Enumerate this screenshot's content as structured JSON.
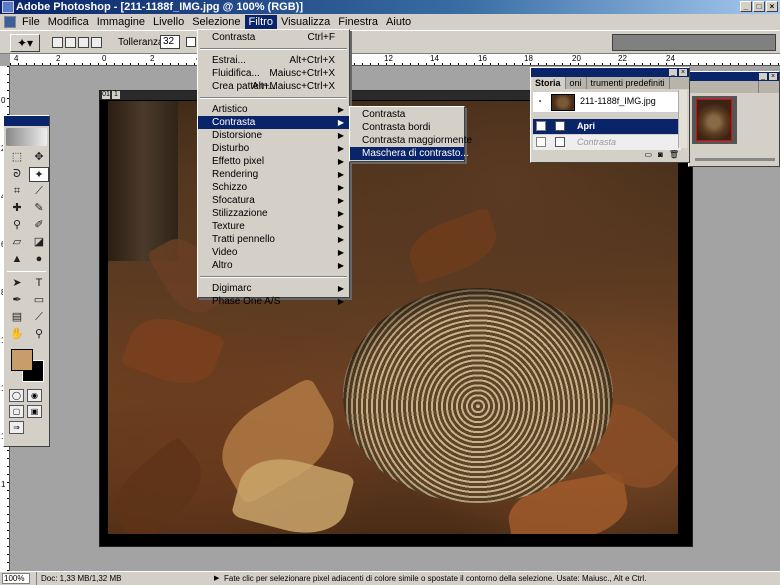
{
  "window": {
    "title": "Adobe Photoshop - [211-1188f_IMG.jpg @ 100% (RGB)]",
    "buttons": [
      "_",
      "□",
      "×"
    ],
    "doc_buttons": [
      "_",
      "□",
      "×"
    ]
  },
  "menubar": {
    "items": [
      "File",
      "Modifica",
      "Immagine",
      "Livello",
      "Selezione",
      "Filtro",
      "Visualizza",
      "Finestra",
      "Aiuto"
    ]
  },
  "options": {
    "tool_icon": "magic-wand",
    "tolerance_label": "Tolleranza:",
    "tolerance_value": "32"
  },
  "rulers": {
    "top": [
      "4",
      "2",
      "0",
      "2",
      "4",
      "6",
      "8",
      "10",
      "12",
      "14",
      "16",
      "18",
      "20",
      "22",
      "24"
    ],
    "left": [
      "0",
      "2",
      "4",
      "6",
      "8",
      "1",
      "1",
      "1",
      "1"
    ]
  },
  "filter_menu": {
    "items": [
      {
        "label": "Contrasta",
        "shortcut": "Ctrl+F"
      },
      {
        "label": "Estrai...",
        "shortcut": "Alt+Ctrl+X"
      },
      {
        "label": "Fluidifica...",
        "shortcut": "Maiusc+Ctrl+X"
      },
      {
        "label": "Crea pattern...",
        "shortcut": "Alt+Maiusc+Ctrl+X"
      },
      {
        "label": "Artistico"
      },
      {
        "label": "Contrasta"
      },
      {
        "label": "Distorsione"
      },
      {
        "label": "Disturbo"
      },
      {
        "label": "Effetto pixel"
      },
      {
        "label": "Rendering"
      },
      {
        "label": "Schizzo"
      },
      {
        "label": "Sfocatura"
      },
      {
        "label": "Stilizzazione"
      },
      {
        "label": "Texture"
      },
      {
        "label": "Tratti pennello"
      },
      {
        "label": "Video"
      },
      {
        "label": "Altro"
      },
      {
        "label": "Digimarc"
      },
      {
        "label": "Phase One A/S"
      }
    ]
  },
  "sharpen_submenu": {
    "items": [
      "Contrasta",
      "Contrasta bordi",
      "Contrasta maggiormente",
      "Maschera di contrasto..."
    ]
  },
  "history_palette": {
    "tabs": [
      "Storia",
      "oni",
      "trumenti predefiniti"
    ],
    "snapshot": "211-1188f_IMG.jpg",
    "states": [
      "Apri",
      "Contrasta"
    ]
  },
  "document": {
    "buttons": [
      "01",
      "1"
    ]
  },
  "colors": {
    "foreground": "#c99c6b",
    "background": "#000000",
    "highlight": "#0a246a"
  },
  "status": {
    "zoom": "100%",
    "doc": "Doc: 1,33 MB/1,32 MB",
    "hint": "Fate clic per selezionare pixel adiacenti di colore simile o spostate il contorno della selezione. Usate: Maiusc., Alt e Ctrl."
  }
}
